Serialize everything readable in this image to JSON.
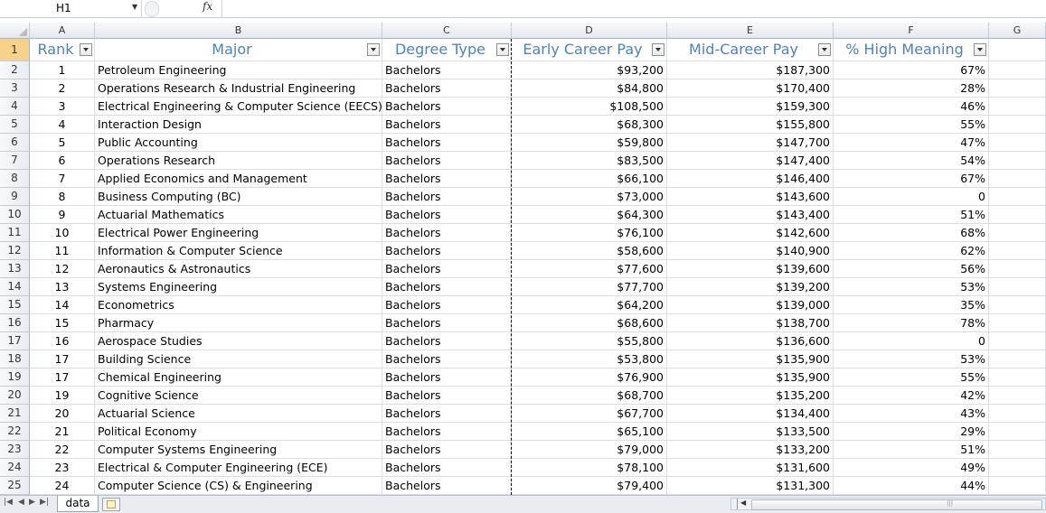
{
  "formula_bar": {
    "name_box": "H1",
    "fx_label": "fx",
    "formula": ""
  },
  "column_letters": [
    "A",
    "B",
    "C",
    "D",
    "E",
    "F",
    "G"
  ],
  "table": {
    "headers": [
      "Rank",
      "Major",
      "Degree Type",
      "Early Career Pay",
      "Mid-Career Pay",
      "% High Meaning"
    ],
    "rows": [
      [
        "1",
        "Petroleum Engineering",
        "Bachelors",
        "$93,200",
        "$187,300",
        "67%"
      ],
      [
        "2",
        "Operations Research & Industrial Engineering",
        "Bachelors",
        "$84,800",
        "$170,400",
        "28%"
      ],
      [
        "3",
        "Electrical Engineering & Computer Science (EECS)",
        "Bachelors",
        "$108,500",
        "$159,300",
        "46%"
      ],
      [
        "4",
        "Interaction Design",
        "Bachelors",
        "$68,300",
        "$155,800",
        "55%"
      ],
      [
        "5",
        "Public Accounting",
        "Bachelors",
        "$59,800",
        "$147,700",
        "47%"
      ],
      [
        "6",
        "Operations Research",
        "Bachelors",
        "$83,500",
        "$147,400",
        "54%"
      ],
      [
        "7",
        "Applied Economics and Management",
        "Bachelors",
        "$66,100",
        "$146,400",
        "67%"
      ],
      [
        "8",
        "Business Computing (BC)",
        "Bachelors",
        "$73,000",
        "$143,600",
        "0"
      ],
      [
        "9",
        "Actuarial Mathematics",
        "Bachelors",
        "$64,300",
        "$143,400",
        "51%"
      ],
      [
        "10",
        "Electrical Power Engineering",
        "Bachelors",
        "$76,100",
        "$142,600",
        "68%"
      ],
      [
        "11",
        "Information & Computer Science",
        "Bachelors",
        "$58,600",
        "$140,900",
        "62%"
      ],
      [
        "12",
        "Aeronautics & Astronautics",
        "Bachelors",
        "$77,600",
        "$139,600",
        "56%"
      ],
      [
        "13",
        "Systems Engineering",
        "Bachelors",
        "$77,700",
        "$139,200",
        "53%"
      ],
      [
        "14",
        "Econometrics",
        "Bachelors",
        "$64,200",
        "$139,000",
        "35%"
      ],
      [
        "15",
        "Pharmacy",
        "Bachelors",
        "$68,600",
        "$138,700",
        "78%"
      ],
      [
        "16",
        "Aerospace Studies",
        "Bachelors",
        "$55,800",
        "$136,600",
        "0"
      ],
      [
        "17",
        "Building Science",
        "Bachelors",
        "$53,800",
        "$135,900",
        "53%"
      ],
      [
        "17",
        "Chemical Engineering",
        "Bachelors",
        "$76,900",
        "$135,900",
        "55%"
      ],
      [
        "19",
        "Cognitive Science",
        "Bachelors",
        "$68,700",
        "$135,200",
        "42%"
      ],
      [
        "20",
        "Actuarial Science",
        "Bachelors",
        "$67,700",
        "$134,400",
        "43%"
      ],
      [
        "21",
        "Political Economy",
        "Bachelors",
        "$65,100",
        "$133,500",
        "29%"
      ],
      [
        "22",
        "Computer Systems Engineering",
        "Bachelors",
        "$79,000",
        "$133,200",
        "51%"
      ],
      [
        "23",
        "Electrical & Computer Engineering (ECE)",
        "Bachelors",
        "$78,100",
        "$131,600",
        "49%"
      ],
      [
        "24",
        "Computer Science (CS) & Engineering",
        "Bachelors",
        "$79,400",
        "$131,300",
        "44%"
      ]
    ]
  },
  "sheet_tabs": [
    "data"
  ],
  "colors": {
    "header_text": "#4f81bd",
    "selected_row_header": "#f6d28a"
  }
}
